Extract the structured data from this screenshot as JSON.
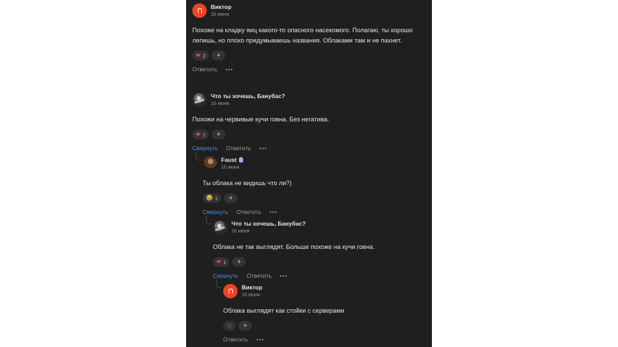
{
  "comments": [
    {
      "author": "Виктор",
      "date": "16 июня",
      "avatar_color": "#ef4423",
      "text": "Похоже на кладку яиц какого-то опасного насекомого. Полагаю, ты хорошо лепишь, но плохо придумываешь названия. Облаками там и не пахнет.",
      "reaction_count": "2",
      "reply_label": "Ответить"
    },
    {
      "author": "Что ты хочешь, Банубас?",
      "date": "16 июня",
      "text": "Похожи на червивые кучи говна. Без негатива.",
      "reaction_count": "1",
      "collapse_label": "Свернуть",
      "reply_label": "Ответить"
    },
    {
      "author": "Faust",
      "date": "16 июня",
      "text": "Ты облака не видишь что ли?)",
      "reaction_count": "1",
      "collapse_label": "Свернуть",
      "reply_label": "Ответить"
    },
    {
      "author": "Что ты хочешь, Банубас?",
      "date": "16 июня",
      "text": "Облака не так выглядят. Больше похоже на кучи говна.",
      "reaction_count": "1",
      "collapse_label": "Свернуть",
      "reply_label": "Ответить"
    },
    {
      "author": "Виктор",
      "date": "16 июня",
      "avatar_color": "#ef4423",
      "text": "Облака выглядят как стойки с серверами",
      "reply_label": "Ответить"
    }
  ],
  "icons": {
    "heart": "heart-icon",
    "heart_outline": "heart-outline-icon",
    "laugh": "laughing-emoji-icon",
    "plus": "plus-icon",
    "more": "more-dots-icon",
    "verified": "verified-badge-icon"
  },
  "colors": {
    "background": "#1f1f20",
    "link": "#4f8fe0",
    "heart": "#ee3d52"
  }
}
